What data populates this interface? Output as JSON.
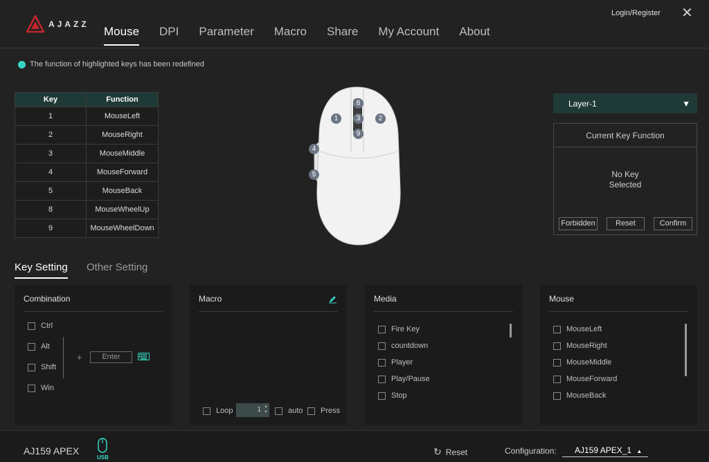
{
  "app": {
    "brand": "AJAZZ",
    "login_label": "Login/Register",
    "close_icon": "close-icon"
  },
  "nav": {
    "tabs": [
      "Mouse",
      "DPI",
      "Parameter",
      "Macro",
      "Share",
      "My Account",
      "About"
    ],
    "active": "Mouse"
  },
  "notice": {
    "text": "The function of highlighted keys has been redefined",
    "dot_color": "#36d6c4"
  },
  "key_table": {
    "headers": [
      "Key",
      "Function"
    ],
    "rows": [
      [
        "1",
        "MouseLeft"
      ],
      [
        "2",
        "MouseRight"
      ],
      [
        "3",
        "MouseMiddle"
      ],
      [
        "4",
        "MouseForward"
      ],
      [
        "5",
        "MouseBack"
      ],
      [
        "8",
        "MouseWheelUp"
      ],
      [
        "9",
        "MouseWheelDown"
      ]
    ]
  },
  "mouse_image": {
    "badges": [
      "1",
      "2",
      "3",
      "4",
      "5",
      "8",
      "9"
    ]
  },
  "layer": {
    "selected": "Layer-1"
  },
  "current_key": {
    "title": "Current Key Function",
    "message_line1": "No Key",
    "message_line2": "Selected",
    "buttons": [
      "Forbidden",
      "Reset",
      "Confirm"
    ]
  },
  "subtabs": {
    "key_setting": "Key Setting",
    "other_setting": "Other Setting"
  },
  "combination": {
    "title": "Combination",
    "modifiers": [
      "Ctrl",
      "Alt",
      "Shift",
      "Win"
    ],
    "plus": "+",
    "key_value": "Enter",
    "keyboard_icon": "keyboard-icon"
  },
  "macro": {
    "title": "Macro",
    "edit_icon": "pencil-icon",
    "loop_label": "Loop",
    "loop_count": "1",
    "auto_label": "auto",
    "press_label": "Press"
  },
  "media": {
    "title": "Media",
    "items": [
      "Fire Key",
      "countdown",
      "Player",
      "Play/Pause",
      "Stop"
    ]
  },
  "mouse_panel": {
    "title": "Mouse",
    "items": [
      "MouseLeft",
      "MouseRight",
      "MouseMiddle",
      "MouseForward",
      "MouseBack"
    ]
  },
  "footer": {
    "device": "AJ159 APEX",
    "connection": "USB",
    "reset_label": "Reset",
    "config_label": "Configuration:",
    "config_value": "AJ159 APEX_1"
  },
  "colors": {
    "accent": "#36d6c4",
    "header_fill": "#1f3a36",
    "background": "#222222"
  }
}
